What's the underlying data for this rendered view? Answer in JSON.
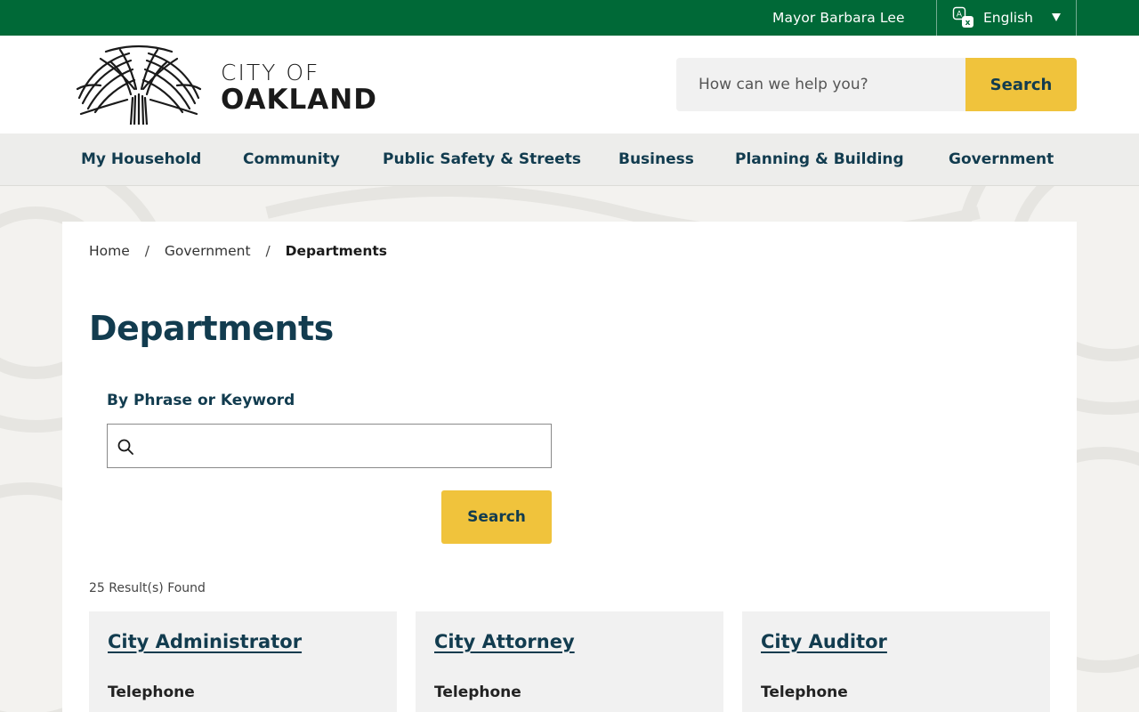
{
  "topbar": {
    "mayor_link": "Mayor Barbara Lee",
    "language": "English"
  },
  "header": {
    "logo": {
      "line1": "CITY OF",
      "line2": "OAKLAND"
    },
    "search": {
      "placeholder": "How can we help you?",
      "button_label": "Search"
    }
  },
  "nav": {
    "items": [
      "My Household",
      "Community",
      "Public Safety & Streets",
      "Business",
      "Planning & Building",
      "Government"
    ]
  },
  "breadcrumb": {
    "home": "Home",
    "parent": "Government",
    "current": "Departments",
    "separator": "/"
  },
  "page": {
    "title": "Departments",
    "filter_label": "By Phrase or Keyword",
    "filter_value": "",
    "search_button": "Search",
    "results_count": "25 Result(s) Found"
  },
  "cards": [
    {
      "title": "City Administrator",
      "phone_label": "Telephone",
      "phone": ""
    },
    {
      "title": "City Attorney",
      "phone_label": "Telephone",
      "phone": ""
    },
    {
      "title": "City Auditor",
      "phone_label": "Telephone",
      "phone": ""
    }
  ],
  "colors": {
    "topbar": "#006937",
    "accent_yellow": "#f0c33c",
    "navy": "#123c4f",
    "nav_background": "#ededeb"
  },
  "icons": [
    "translate-icon",
    "chevron-down-icon",
    "oakland-tree-logo",
    "search-icon"
  ]
}
